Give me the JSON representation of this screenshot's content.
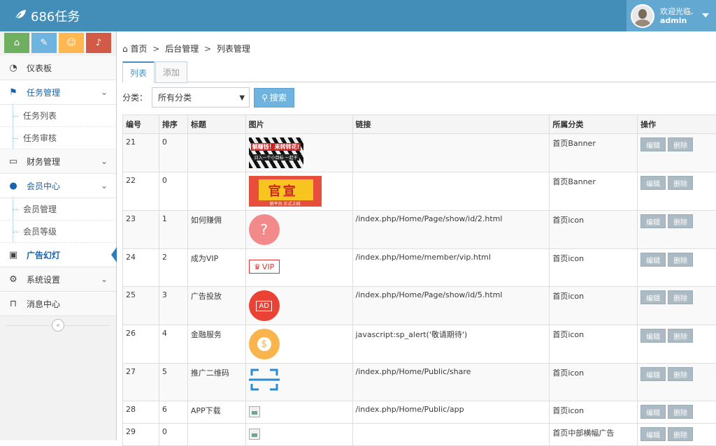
{
  "app": {
    "title": "686任务"
  },
  "user": {
    "greeting": "欢迎光临,",
    "name": "admin"
  },
  "shortcuts": [
    {
      "icon": "home-icon",
      "glyph": "⌂",
      "color": "#6fb060"
    },
    {
      "icon": "pencil-icon",
      "glyph": "✎",
      "color": "#6fb3e0"
    },
    {
      "icon": "users-icon",
      "glyph": "☺",
      "color": "#ffb752"
    },
    {
      "icon": "bell-icon",
      "glyph": "♪",
      "color": "#d15b47"
    }
  ],
  "sidebar": {
    "dashboard": "仪表板",
    "task_mgmt": "任务管理",
    "task_list": "任务列表",
    "task_review": "任务审核",
    "finance": "财务管理",
    "member_center": "会员中心",
    "member_mgmt": "会员管理",
    "member_level": "会员等级",
    "ads": "广告幻灯",
    "settings": "系统设置",
    "messages": "消息中心",
    "collapse": "«"
  },
  "breadcrumb": {
    "home": "首页",
    "sep": ">",
    "admin": "后台管理",
    "current": "列表管理"
  },
  "tabs": {
    "list": "列表",
    "add": "添加"
  },
  "filter": {
    "label": "分类：",
    "selected": "所有分类",
    "search": "搜索"
  },
  "table": {
    "headers": {
      "id": "编号",
      "order": "排序",
      "title": "标题",
      "image": "图片",
      "link": "链接",
      "category": "所属分类",
      "ops": "操作"
    },
    "edit": "编辑",
    "delete": "删除",
    "rows": [
      {
        "id": "21",
        "order": "0",
        "title": "",
        "link": "",
        "category": "首页Banner",
        "banner_text": "躺赚钱！来转转花!",
        "banner_sub": "日入一个小目标 一起干"
      },
      {
        "id": "22",
        "order": "0",
        "title": "",
        "link": "",
        "category": "首页Banner",
        "banner_text": "官宣",
        "banner_sub": "新平台 正式上线"
      },
      {
        "id": "23",
        "order": "1",
        "title": "如何赚佣",
        "link": "/index.php/Home/Page/show/id/2.html",
        "category": "首页icon",
        "icon_text": "?"
      },
      {
        "id": "24",
        "order": "2",
        "title": "成为VIP",
        "link": "/index.php/Home/member/vip.html",
        "category": "首页icon",
        "icon_text": "VIP"
      },
      {
        "id": "25",
        "order": "3",
        "title": "广告投放",
        "link": "/index.php/Home/Page/show/id/5.html",
        "category": "首页icon",
        "icon_text": "AD"
      },
      {
        "id": "26",
        "order": "4",
        "title": "金融服务",
        "link": "javascript:sp_alert('敬请期待')",
        "category": "首页icon",
        "icon_text": "$"
      },
      {
        "id": "27",
        "order": "5",
        "title": "推广二维码",
        "link": "/index.php/Home/Public/share",
        "category": "首页icon"
      },
      {
        "id": "28",
        "order": "6",
        "title": "APP下载",
        "link": "/index.php/Home/Public/app",
        "category": "首页icon"
      },
      {
        "id": "29",
        "order": "0",
        "title": "",
        "link": "",
        "category": "首页中部横幅广告"
      }
    ]
  }
}
